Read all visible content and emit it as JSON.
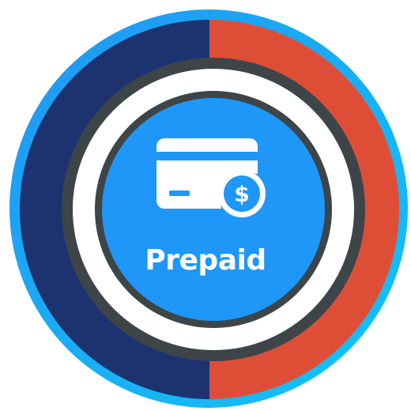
{
  "badge": {
    "label": "Prepaid",
    "icon": "credit-card-dollar-icon",
    "colors": {
      "outer_ring": "#1AA3F2",
      "left_half": "#1C3370",
      "right_half": "#DE4E37",
      "dark_ring": "#3D4548",
      "white_ring": "#FFFFFF",
      "center": "#1F97F9",
      "icon": "#FFFFFF"
    }
  }
}
